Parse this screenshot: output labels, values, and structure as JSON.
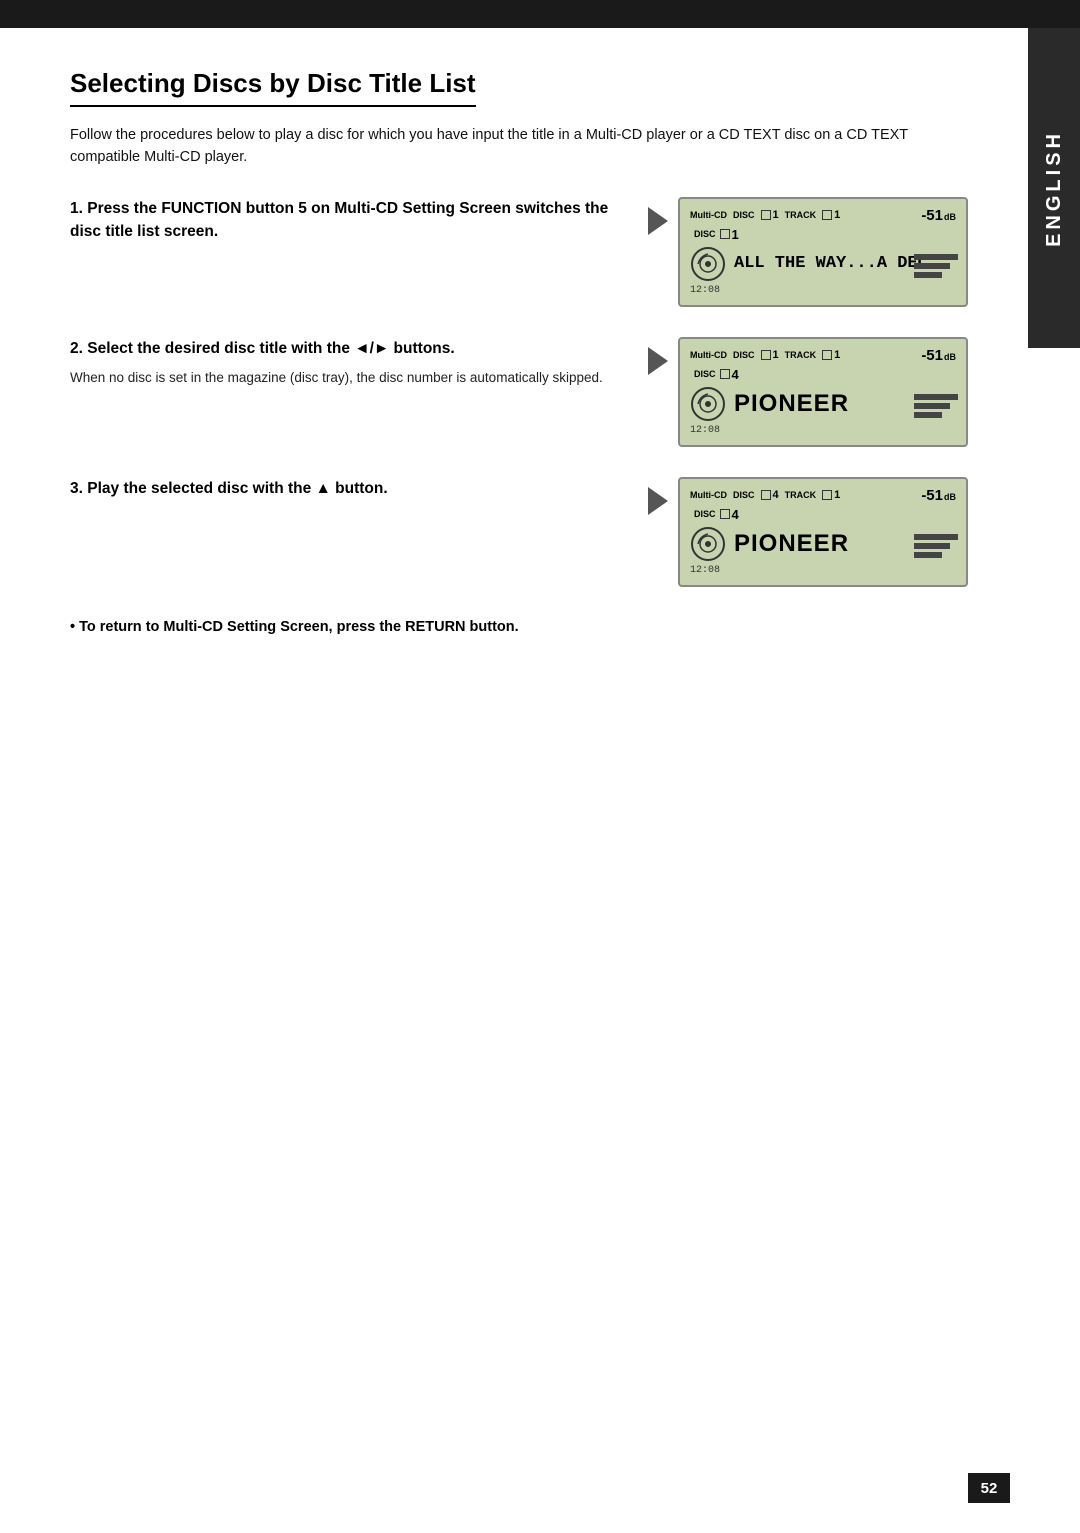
{
  "topBar": {},
  "sideTab": {
    "text": "ENGLISH"
  },
  "page": {
    "title": "Selecting Discs by Disc Title List",
    "intro": "Follow the procedures below to play a disc for which you have input the title in a Multi-CD player or a CD TEXT disc on a CD TEXT compatible Multi-CD player.",
    "steps": [
      {
        "number": "1.",
        "heading": "Press the FUNCTION button 5 on Multi-CD Setting Screen switches the disc title list screen.",
        "note": "",
        "display": {
          "multiCd": "Multi-CD",
          "discLabel": "DISC",
          "discBox": "□",
          "discNum": "1",
          "trackLabel": "TRACK",
          "trackBox": "□",
          "trackNum": "1",
          "db": "-51",
          "dbUnit": "dB",
          "discLine2Label": "DISC",
          "discLine2Box": "□",
          "discLine2Num": "1",
          "titleText": "ALL THE WAY...A DECA",
          "time": "12:08"
        }
      },
      {
        "number": "2.",
        "heading": "Select the desired disc title with the ◄/► buttons.",
        "note": "When no disc is set in the magazine (disc tray), the disc number is automatically skipped.",
        "display": {
          "multiCd": "Multi-CD",
          "discLabel": "DISC",
          "discBox": "□",
          "discNum": "1",
          "trackLabel": "TRACK",
          "trackBox": "□",
          "trackNum": "1",
          "db": "-51",
          "dbUnit": "dB",
          "discLine2Label": "DISC",
          "discLine2Box": "□",
          "discLine2Num": "4",
          "titleText": "PIONEER",
          "time": "12:08"
        }
      },
      {
        "number": "3.",
        "heading": "Play the selected disc with the ▲ button.",
        "note": "",
        "display": {
          "multiCd": "Multi-CD",
          "discLabel": "DISC",
          "discBox": "□",
          "discNum": "4",
          "trackLabel": "TRACK",
          "trackBox": "□",
          "trackNum": "1",
          "db": "-51",
          "dbUnit": "dB",
          "discLine2Label": "DISC",
          "discLine2Box": "□",
          "discLine2Num": "4",
          "titleText": "PIONEER",
          "time": "12:08"
        }
      }
    ],
    "bulletNote": "• To return to Multi-CD Setting Screen, press the RETURN button.",
    "pageNumber": "52"
  }
}
